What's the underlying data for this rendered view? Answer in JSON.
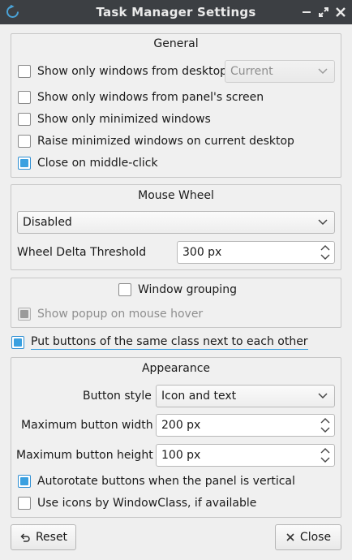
{
  "window": {
    "title": "Task Manager Settings"
  },
  "general": {
    "title": "General",
    "desktop_only": {
      "label": "Show only windows from desktop",
      "checked": false
    },
    "desktop_combo": {
      "value": "Current"
    },
    "panel_screen": {
      "label": "Show only windows from panel's screen",
      "checked": false
    },
    "minimized_only": {
      "label": "Show only minimized windows",
      "checked": false
    },
    "raise_minimized": {
      "label": "Raise minimized windows on current desktop",
      "checked": false
    },
    "close_middle": {
      "label": "Close on middle-click",
      "checked": true
    }
  },
  "mouse_wheel": {
    "title": "Mouse Wheel",
    "mode": {
      "value": "Disabled"
    },
    "threshold": {
      "label": "Wheel Delta Threshold",
      "value": "300 px"
    }
  },
  "grouping": {
    "window_grouping": {
      "label": "Window grouping",
      "checked": false
    },
    "popup_hover": {
      "label": "Show popup on mouse hover",
      "checked": true
    }
  },
  "same_class": {
    "label": "Put buttons of the same class next to each other",
    "checked": true
  },
  "appearance": {
    "title": "Appearance",
    "button_style": {
      "label": "Button style",
      "value": "Icon and text"
    },
    "max_width": {
      "label": "Maximum button width",
      "value": "200 px"
    },
    "max_height": {
      "label": "Maximum button height",
      "value": "100 px"
    },
    "autorotate": {
      "label": "Autorotate buttons when the panel is vertical",
      "checked": true
    },
    "window_class_icons": {
      "label": "Use icons by WindowClass, if available",
      "checked": false
    }
  },
  "buttons": {
    "reset": "Reset",
    "close": "Close"
  },
  "colors": {
    "accent": "#3aa0e0",
    "titlebar": "#3c3f43"
  }
}
